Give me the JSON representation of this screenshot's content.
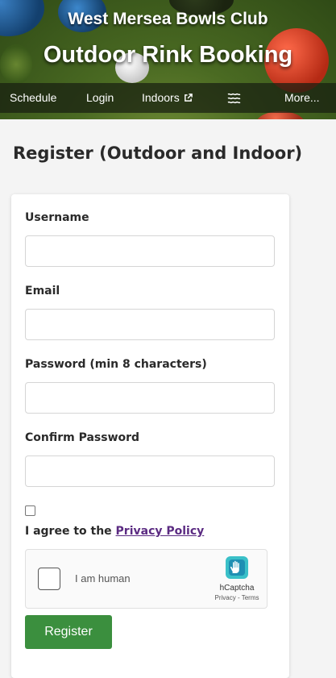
{
  "header": {
    "club_name": "West Mersea Bowls Club",
    "site_title": "Outdoor Rink Booking"
  },
  "nav": {
    "items": [
      {
        "label": "Schedule",
        "icon": ""
      },
      {
        "label": "Login",
        "icon": ""
      },
      {
        "label": "Indoors",
        "icon": "external-link-icon"
      },
      {
        "label": "",
        "icon": "hamburger-icon"
      },
      {
        "label": "More...",
        "icon": ""
      }
    ]
  },
  "page": {
    "heading": "Register (Outdoor and Indoor)"
  },
  "form": {
    "fields": [
      {
        "label": "Username",
        "value": ""
      },
      {
        "label": "Email",
        "value": ""
      },
      {
        "label": "Password (min 8 characters)",
        "value": ""
      },
      {
        "label": "Confirm Password",
        "value": ""
      }
    ],
    "agree_prefix": "I agree to the ",
    "agree_link": "Privacy Policy",
    "agree_checked": false,
    "captcha": {
      "label": "I am human",
      "brand": "hCaptcha",
      "legal": "Privacy - Terms"
    },
    "submit_label": "Register"
  },
  "colors": {
    "submit_bg": "#3b8f3e",
    "link": "#5b2b82",
    "nav_bg": "#181e10"
  }
}
